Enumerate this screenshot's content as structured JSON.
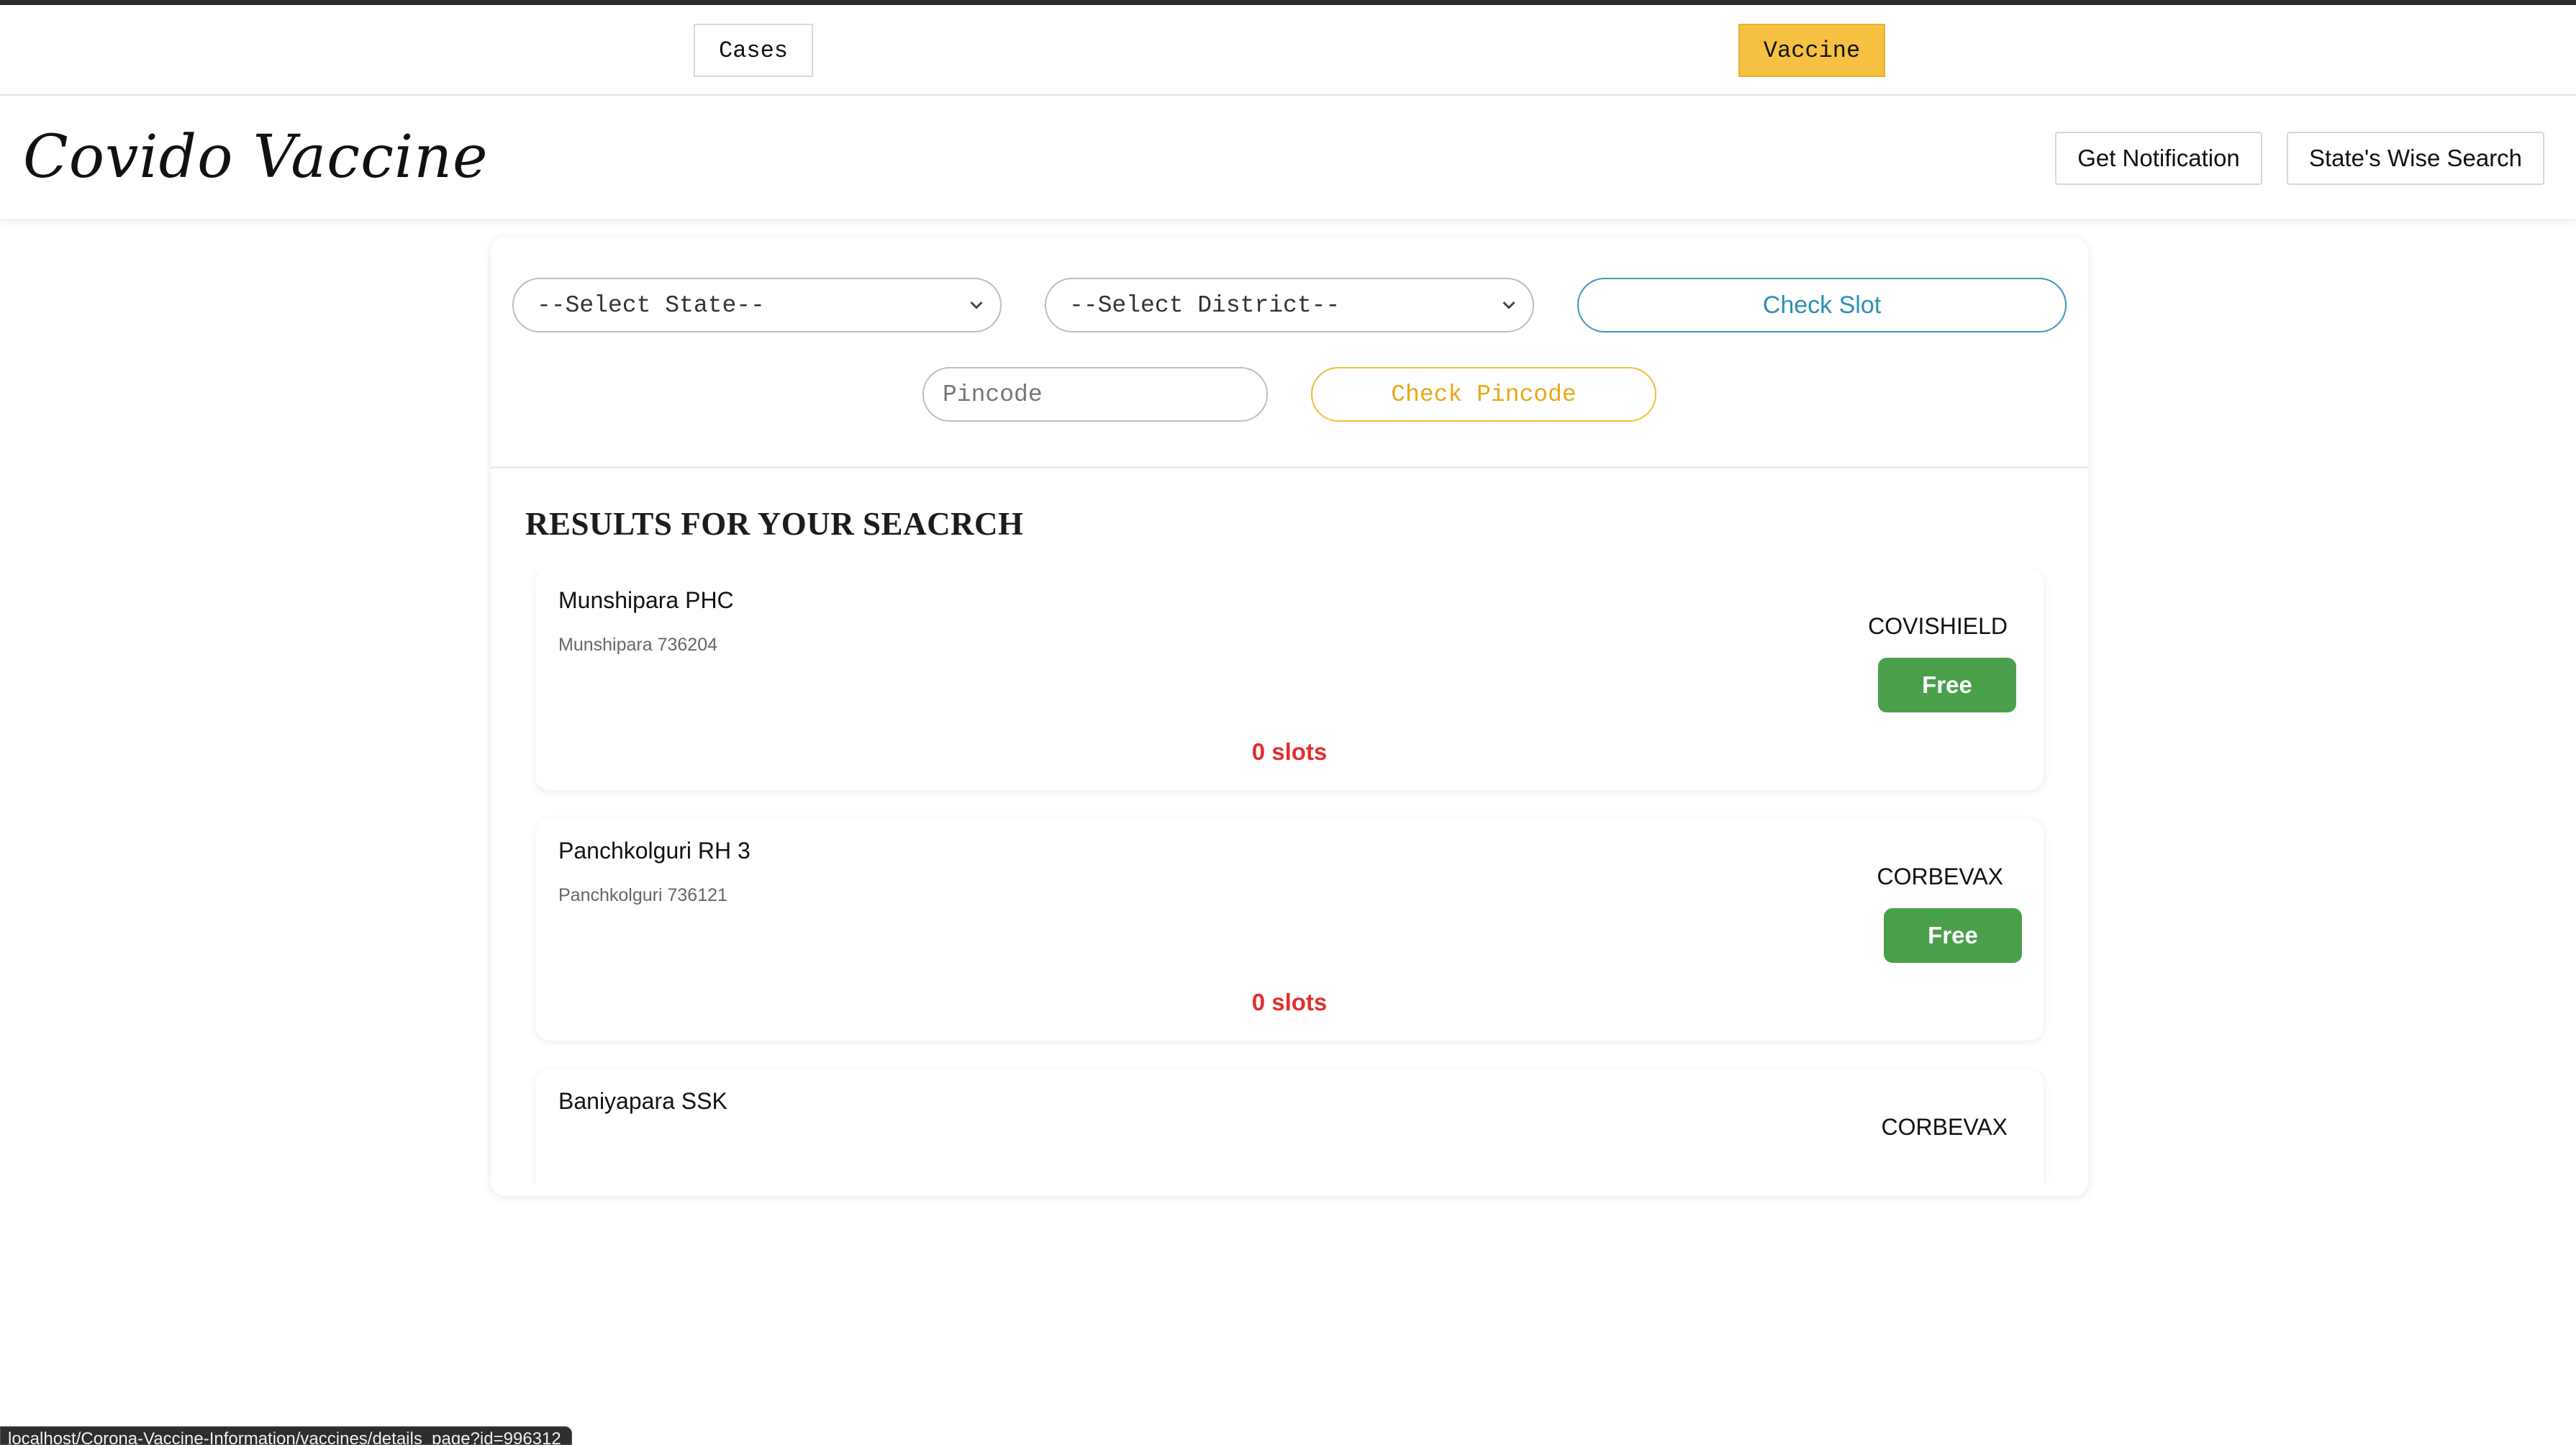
{
  "nav": {
    "cases_label": "Cases",
    "vaccine_label": "Vaccine"
  },
  "header": {
    "brand": "Covido Vaccine",
    "get_notification_label": "Get Notification",
    "state_wise_search_label": "State's Wise Search"
  },
  "search": {
    "state_select": "--Select State--",
    "district_select": "--Select District--",
    "check_slot_label": "Check Slot",
    "pincode_placeholder": "Pincode",
    "check_pincode_label": "Check Pincode"
  },
  "results": {
    "title": "RESULTS FOR YOUR SEACRCH",
    "items": [
      {
        "name": "Munshipara PHC",
        "address": "Munshipara 736204",
        "vaccine": "COVISHIELD",
        "fee": "Free",
        "slots": "0 slots"
      },
      {
        "name": "Panchkolguri RH 3",
        "address": "Panchkolguri 736121",
        "vaccine": "CORBEVAX",
        "fee": "Free",
        "slots": "0 slots"
      },
      {
        "name": "Baniyapara SSK",
        "address": "",
        "vaccine": "CORBEVAX",
        "fee": "",
        "slots": ""
      }
    ]
  },
  "status_bar": {
    "url": "localhost/Corona-Vaccine-Information/vaccines/details_page?id=996312"
  },
  "colors": {
    "accent_yellow": "#f6c142",
    "check_slot_blue": "#2d8fb3",
    "free_green": "#4aa04a",
    "slots_red": "#e0302d"
  }
}
